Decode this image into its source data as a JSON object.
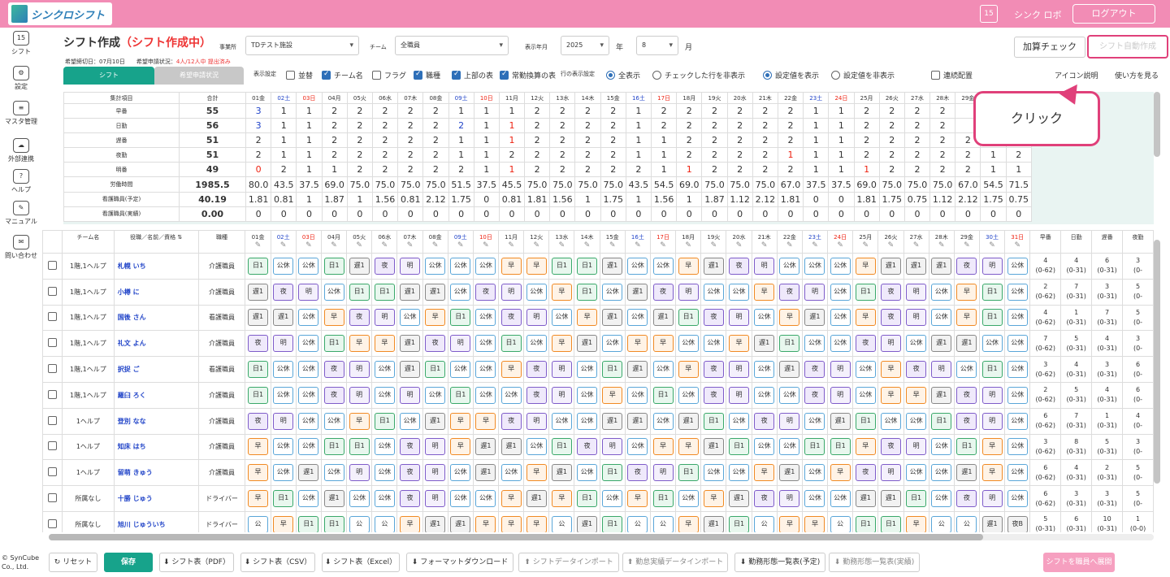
{
  "app": {
    "logo": "シンクロシフト",
    "user": "シンク ロボ",
    "logout": "ログアウト",
    "cal": "15"
  },
  "sidebar": [
    {
      "ic": "15",
      "label": "シフト"
    },
    {
      "ic": "⚙",
      "label": "設定"
    },
    {
      "ic": "≡",
      "label": "マスタ管理"
    },
    {
      "ic": "☁",
      "label": "外部連携"
    },
    {
      "ic": "?",
      "label": "ヘルプ"
    },
    {
      "ic": "✎",
      "label": "マニュアル"
    },
    {
      "ic": "✉",
      "label": "問い合わせ"
    }
  ],
  "copyright": "© SynCube Co., Ltd.",
  "header": {
    "title": "シフト作成",
    "status": "（シフト作成中）",
    "deadline": "希望締切日：07月10日",
    "req_label": "希望申請状況：",
    "req_value": "4人/12人中 提出済み",
    "jigyosho_label": "事業所",
    "jigyosho": "TDテスト施設",
    "team_label": "チーム",
    "team": "全職員",
    "ym_label": "表示年月",
    "year": "2025",
    "year_unit": "年",
    "month": "8",
    "month_unit": "月",
    "kasan": "加算チェック",
    "auto": "シフト自動作成"
  },
  "tabs": {
    "shift": "シフト",
    "request": "希望申請状況"
  },
  "options": {
    "label": "表示設定",
    "namikae": "並替",
    "team_name": "チーム名",
    "flag": "フラグ",
    "shokushu": "職種",
    "top_table": "上部の表",
    "jokin": "常勤換算の表",
    "row_label": "行の表示設定",
    "show_all": "全表示",
    "hide_checked": "チェックした行を非表示",
    "show_setting": "設定値を表示",
    "hide_setting": "設定値を非表示",
    "renzoku": "連続配置",
    "icon_desc": "アイコン説明",
    "howto": "使い方を見る"
  },
  "callout": "クリック",
  "days": [
    [
      "01",
      "金"
    ],
    [
      "02",
      "土"
    ],
    [
      "03",
      "日"
    ],
    [
      "04",
      "月"
    ],
    [
      "05",
      "火"
    ],
    [
      "06",
      "水"
    ],
    [
      "07",
      "木"
    ],
    [
      "08",
      "金"
    ],
    [
      "09",
      "土"
    ],
    [
      "10",
      "日"
    ],
    [
      "11",
      "月"
    ],
    [
      "12",
      "火"
    ],
    [
      "13",
      "水"
    ],
    [
      "14",
      "木"
    ],
    [
      "15",
      "金"
    ],
    [
      "16",
      "土"
    ],
    [
      "17",
      "日"
    ],
    [
      "18",
      "月"
    ],
    [
      "19",
      "火"
    ],
    [
      "20",
      "水"
    ],
    [
      "21",
      "木"
    ],
    [
      "22",
      "金"
    ],
    [
      "23",
      "土"
    ],
    [
      "24",
      "日"
    ],
    [
      "25",
      "月"
    ],
    [
      "26",
      "火"
    ],
    [
      "27",
      "水"
    ],
    [
      "28",
      "木"
    ],
    [
      "29",
      "金"
    ],
    [
      "30",
      "土"
    ],
    [
      "31",
      "日"
    ]
  ],
  "summary": {
    "head_item": "集計項目",
    "head_total": "合計",
    "rows": [
      {
        "label": "早番",
        "total": "55",
        "v": [
          "3",
          "1",
          "1",
          "2",
          "2",
          "2",
          "2",
          "2",
          "1",
          "1",
          "1",
          "2",
          "2",
          "2",
          "2",
          "1",
          "2",
          "2",
          "2",
          "2",
          "2",
          "2",
          "1",
          "1",
          "2",
          "2",
          "2",
          "2",
          "",
          "",
          ""
        ]
      },
      {
        "label": "日勤",
        "total": "56",
        "v": [
          "3",
          "1",
          "1",
          "2",
          "2",
          "2",
          "2",
          "2",
          "2",
          "1",
          "1",
          "2",
          "2",
          "2",
          "2",
          "1",
          "2",
          "2",
          "2",
          "2",
          "2",
          "2",
          "1",
          "1",
          "2",
          "2",
          "2",
          "2",
          "",
          "",
          ""
        ]
      },
      {
        "label": "遅番",
        "total": "51",
        "v": [
          "2",
          "1",
          "1",
          "2",
          "2",
          "2",
          "2",
          "2",
          "1",
          "1",
          "1",
          "2",
          "2",
          "2",
          "2",
          "1",
          "1",
          "2",
          "2",
          "2",
          "2",
          "2",
          "1",
          "1",
          "2",
          "2",
          "2",
          "2",
          "2",
          "1",
          "1"
        ]
      },
      {
        "label": "夜勤",
        "total": "51",
        "v": [
          "2",
          "1",
          "1",
          "2",
          "2",
          "2",
          "2",
          "2",
          "1",
          "1",
          "2",
          "2",
          "2",
          "2",
          "2",
          "1",
          "1",
          "2",
          "2",
          "2",
          "2",
          "1",
          "1",
          "1",
          "2",
          "2",
          "2",
          "2",
          "2",
          "1",
          "2"
        ]
      },
      {
        "label": "明番",
        "total": "49",
        "v": [
          "0",
          "2",
          "1",
          "1",
          "2",
          "2",
          "2",
          "2",
          "2",
          "1",
          "1",
          "2",
          "2",
          "2",
          "2",
          "2",
          "1",
          "1",
          "2",
          "2",
          "2",
          "2",
          "1",
          "1",
          "1",
          "2",
          "2",
          "2",
          "2",
          "1",
          "1"
        ]
      },
      {
        "label": "労働時間",
        "total": "1985.5",
        "v": [
          "80.0",
          "43.5",
          "37.5",
          "69.0",
          "75.0",
          "75.0",
          "75.0",
          "75.0",
          "51.5",
          "37.5",
          "45.5",
          "75.0",
          "75.0",
          "75.0",
          "75.0",
          "43.5",
          "54.5",
          "69.0",
          "75.0",
          "75.0",
          "75.0",
          "67.0",
          "37.5",
          "37.5",
          "69.0",
          "75.0",
          "75.0",
          "75.0",
          "67.0",
          "54.5",
          "71.5"
        ]
      },
      {
        "label": "看護職員(予定)",
        "total": "40.19",
        "v": [
          "1.81",
          "0.81",
          "1",
          "1.87",
          "1",
          "1.56",
          "0.81",
          "2.12",
          "1.75",
          "0",
          "0.81",
          "1.81",
          "1.56",
          "1",
          "1.75",
          "1",
          "1.56",
          "1",
          "1.87",
          "1.12",
          "2.12",
          "1.81",
          "0",
          "0",
          "1.81",
          "1.75",
          "0.75",
          "1.12",
          "2.12",
          "1.75",
          "0.75"
        ]
      },
      {
        "label": "看護職員(実績)",
        "total": "0.00",
        "v": [
          "0",
          "0",
          "0",
          "0",
          "0",
          "0",
          "0",
          "0",
          "0",
          "0",
          "0",
          "0",
          "0",
          "0",
          "0",
          "0",
          "0",
          "0",
          "0",
          "0",
          "0",
          "0",
          "0",
          "0",
          "0",
          "0",
          "0",
          "0",
          "0",
          "0",
          "0"
        ]
      }
    ]
  },
  "grid": {
    "h_team": "チーム名",
    "h_name": "役職／名前／資格",
    "h_shoku": "職種",
    "sum_heads": [
      "早番",
      "日勤",
      "遅番",
      "夜勤"
    ],
    "staff": [
      {
        "team": "1階,1ヘルプ",
        "name": "札幌 いち",
        "shoku": "介護職員",
        "s": [
          "日1",
          "公休",
          "公休",
          "日1",
          "遅1",
          "夜",
          "明",
          "公休",
          "公休",
          "公休",
          "早",
          "早",
          "日1",
          "日1",
          "遅1",
          "公休",
          "公休",
          "早",
          "遅1",
          "夜",
          "明",
          "公休",
          "公休",
          "公休",
          "早",
          "遅1",
          "遅1",
          "遅1",
          "夜",
          "明",
          "公休"
        ],
        "c": [
          [
            "4",
            "(0-62)"
          ],
          [
            "4",
            "(0-31)"
          ],
          [
            "6",
            "(0-31)"
          ],
          [
            "3",
            "(0-"
          ]
        ]
      },
      {
        "team": "1階,1ヘルプ",
        "name": "小樽 に",
        "shoku": "介護職員",
        "s": [
          "遅1",
          "夜",
          "明",
          "公休",
          "日1",
          "日1",
          "遅1",
          "遅1",
          "公休",
          "夜",
          "明",
          "公休",
          "早",
          "日1",
          "公休",
          "遅1",
          "夜",
          "明",
          "公休",
          "公休",
          "早",
          "夜",
          "明",
          "公休",
          "日1",
          "夜",
          "明",
          "公休",
          "早",
          "日1",
          "公休"
        ],
        "c": [
          [
            "2",
            "(0-62)"
          ],
          [
            "7",
            "(0-31)"
          ],
          [
            "3",
            "(0-31)"
          ],
          [
            "5",
            "(0-"
          ]
        ]
      },
      {
        "team": "1階,1ヘルプ",
        "name": "国後 さん",
        "shoku": "看護職員",
        "s": [
          "遅1",
          "遅1",
          "公休",
          "早",
          "夜",
          "明",
          "公休",
          "早",
          "日1",
          "公休",
          "夜",
          "明",
          "公休",
          "早",
          "遅1",
          "公休",
          "遅1",
          "日1",
          "夜",
          "明",
          "公休",
          "早",
          "遅1",
          "公休",
          "早",
          "夜",
          "明",
          "公休",
          "早",
          "日1",
          "公休"
        ],
        "c": [
          [
            "4",
            "(0-62)"
          ],
          [
            "1",
            "(0-31)"
          ],
          [
            "7",
            "(0-31)"
          ],
          [
            "5",
            "(0-"
          ]
        ]
      },
      {
        "team": "1階,1ヘルプ",
        "name": "礼文 よん",
        "shoku": "介護職員",
        "s": [
          "夜",
          "明",
          "公休",
          "日1",
          "早",
          "早",
          "遅1",
          "夜",
          "明",
          "公休",
          "日1",
          "公休",
          "早",
          "遅1",
          "公休",
          "早",
          "早",
          "公休",
          "公休",
          "早",
          "遅1",
          "日1",
          "公休",
          "公休",
          "夜",
          "明",
          "公休",
          "遅1",
          "遅1",
          "公休",
          "公休"
        ],
        "c": [
          [
            "7",
            "(0-62)"
          ],
          [
            "5",
            "(0-31)"
          ],
          [
            "4",
            "(0-31)"
          ],
          [
            "3",
            "(0-"
          ]
        ]
      },
      {
        "team": "1階,1ヘルプ",
        "name": "択捉 ご",
        "shoku": "看護職員",
        "s": [
          "日1",
          "公休",
          "公休",
          "夜",
          "明",
          "公休",
          "遅1",
          "日1",
          "公休",
          "公休",
          "早",
          "夜",
          "明",
          "公休",
          "日1",
          "遅1",
          "公休",
          "早",
          "夜",
          "明",
          "公休",
          "遅1",
          "夜",
          "明",
          "公休",
          "早",
          "夜",
          "明",
          "公休",
          "日1",
          "公休"
        ],
        "c": [
          [
            "3",
            "(0-62)"
          ],
          [
            "4",
            "(0-31)"
          ],
          [
            "3",
            "(0-31)"
          ],
          [
            "6",
            "(0-"
          ]
        ]
      },
      {
        "team": "1階,1ヘルプ",
        "name": "羅臼 ろく",
        "shoku": "介護職員",
        "s": [
          "日1",
          "公休",
          "公休",
          "夜",
          "明",
          "公休",
          "明",
          "公休",
          "日1",
          "公休",
          "公休",
          "夜",
          "明",
          "公休",
          "早",
          "公休",
          "日1",
          "公休",
          "夜",
          "明",
          "公休",
          "公休",
          "夜",
          "明",
          "公休",
          "早",
          "早",
          "遅1",
          "夜",
          "明",
          "公休"
        ],
        "c": [
          [
            "2",
            "(0-62)"
          ],
          [
            "5",
            "(0-31)"
          ],
          [
            "4",
            "(0-31)"
          ],
          [
            "6",
            "(0-"
          ]
        ]
      },
      {
        "team": "1ヘルプ",
        "name": "登別 なな",
        "shoku": "介護職員",
        "s": [
          "夜",
          "明",
          "公休",
          "公休",
          "早",
          "日1",
          "公休",
          "遅1",
          "早",
          "早",
          "夜",
          "明",
          "公休",
          "公休",
          "遅1",
          "遅1",
          "公休",
          "遅1",
          "日1",
          "公休",
          "夜",
          "明",
          "公休",
          "遅1",
          "日1",
          "公休",
          "公休",
          "日1",
          "夜",
          "明",
          "公休"
        ],
        "c": [
          [
            "6",
            "(0-62)"
          ],
          [
            "7",
            "(0-31)"
          ],
          [
            "1",
            "(0-31)"
          ],
          [
            "4",
            "(0-"
          ]
        ]
      },
      {
        "team": "1ヘルプ",
        "name": "知床 はち",
        "shoku": "介護職員",
        "s": [
          "早",
          "公休",
          "公休",
          "日1",
          "日1",
          "公休",
          "夜",
          "明",
          "早",
          "遅1",
          "遅1",
          "公休",
          "日1",
          "夜",
          "明",
          "公休",
          "早",
          "早",
          "遅1",
          "日1",
          "公休",
          "公休",
          "日1",
          "日1",
          "早",
          "夜",
          "明",
          "公休",
          "日1",
          "早",
          "公休"
        ],
        "c": [
          [
            "3",
            "(0-62)"
          ],
          [
            "8",
            "(0-31)"
          ],
          [
            "5",
            "(0-31)"
          ],
          [
            "3",
            "(0-"
          ]
        ]
      },
      {
        "team": "1ヘルプ",
        "name": "留萌 きゅう",
        "shoku": "介護職員",
        "s": [
          "早",
          "公休",
          "遅1",
          "公休",
          "明",
          "公休",
          "夜",
          "明",
          "公休",
          "遅1",
          "公休",
          "早",
          "遅1",
          "公休",
          "日1",
          "夜",
          "明",
          "日1",
          "公休",
          "公休",
          "早",
          "遅1",
          "公休",
          "早",
          "夜",
          "明",
          "公休",
          "公休",
          "遅1",
          "早",
          "公休"
        ],
        "c": [
          [
            "6",
            "(0-62)"
          ],
          [
            "4",
            "(0-31)"
          ],
          [
            "2",
            "(0-31)"
          ],
          [
            "5",
            "(0-"
          ]
        ]
      },
      {
        "team": "所属なし",
        "name": "十勝 じゅう",
        "shoku": "ドライバー",
        "s": [
          "早",
          "日1",
          "公休",
          "遅1",
          "公休",
          "公休",
          "夜",
          "明",
          "公休",
          "公休",
          "早",
          "遅1",
          "早",
          "日1",
          "公休",
          "早",
          "日1",
          "公休",
          "早",
          "遅1",
          "夜",
          "明",
          "公休",
          "公休",
          "遅1",
          "遅1",
          "日1",
          "公休",
          "夜",
          "明",
          "公休"
        ],
        "c": [
          [
            "6",
            "(0-62)"
          ],
          [
            "3",
            "(0-31)"
          ],
          [
            "3",
            "(0-31)"
          ],
          [
            "5",
            "(0-"
          ]
        ]
      },
      {
        "team": "所属なし",
        "name": "旭川 じゅういち",
        "shoku": "ドライバー",
        "s": [
          "公",
          "早",
          "日1",
          "日1",
          "公",
          "公",
          "早",
          "遅1",
          "遅1",
          "早",
          "早",
          "早",
          "公",
          "遅1",
          "日1",
          "公",
          "公",
          "早",
          "遅1",
          "日1",
          "公",
          "早",
          "早",
          "公",
          "日1",
          "日1",
          "早",
          "公",
          "公",
          "遅1",
          "夜B"
        ],
        "c": [
          [
            "5",
            "(0-31)"
          ],
          [
            "6",
            "(0-31)"
          ],
          [
            "10",
            "(0-31)"
          ],
          [
            "1",
            "(0-0)"
          ]
        ]
      }
    ]
  },
  "bottom": [
    "リセット",
    "保存",
    "シフト表（PDF）",
    "シフト表（CSV）",
    "シフト表（Excel）",
    "フォーマットダウンロード",
    "シフトデータインポート",
    "勤怠実績データインポート",
    "勤務形態一覧表(予定)",
    "勤務形態一覧表(実績)",
    "シフトを職員へ展開"
  ]
}
